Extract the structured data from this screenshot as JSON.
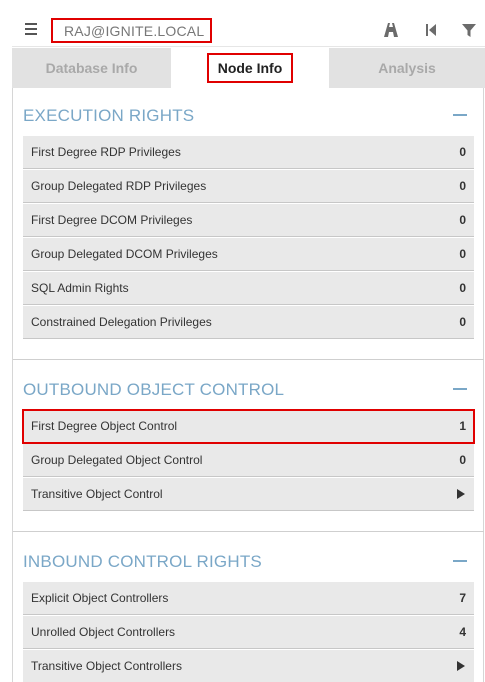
{
  "search": {
    "value": "RAJ@IGNITE.LOCAL"
  },
  "toolbar": {
    "icons": [
      "path-icon",
      "back-icon",
      "filter-icon"
    ]
  },
  "tabs": [
    {
      "label": "Database Info"
    },
    {
      "label": "Node Info"
    },
    {
      "label": "Analysis"
    }
  ],
  "sections": {
    "execution": {
      "title": "EXECUTION RIGHTS",
      "rows": [
        {
          "label": "First Degree RDP Privileges",
          "value": "0"
        },
        {
          "label": "Group Delegated RDP Privileges",
          "value": "0"
        },
        {
          "label": "First Degree DCOM Privileges",
          "value": "0"
        },
        {
          "label": "Group Delegated DCOM Privileges",
          "value": "0"
        },
        {
          "label": "SQL Admin Rights",
          "value": "0"
        },
        {
          "label": "Constrained Delegation Privileges",
          "value": "0"
        }
      ]
    },
    "outbound": {
      "title": "OUTBOUND OBJECT CONTROL",
      "rows": [
        {
          "label": "First Degree Object Control",
          "value": "1"
        },
        {
          "label": "Group Delegated Object Control",
          "value": "0"
        },
        {
          "label": "Transitive Object Control",
          "value": ""
        }
      ]
    },
    "inbound": {
      "title": "INBOUND CONTROL RIGHTS",
      "rows": [
        {
          "label": "Explicit Object Controllers",
          "value": "7"
        },
        {
          "label": "Unrolled Object Controllers",
          "value": "4"
        },
        {
          "label": "Transitive Object Controllers",
          "value": ""
        }
      ]
    }
  },
  "colors": {
    "accent": "#7aa7c7",
    "highlight": "#e00000",
    "row_bg": "#e9e9e9"
  }
}
